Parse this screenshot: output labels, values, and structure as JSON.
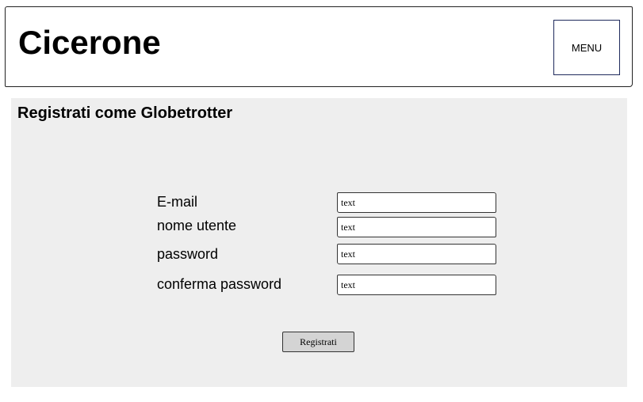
{
  "header": {
    "app_title": "Cicerone",
    "menu_label": "MENU"
  },
  "form": {
    "title": "Registrati come Globetrotter",
    "fields": [
      {
        "label": "E-mail",
        "value": "text"
      },
      {
        "label": "nome utente",
        "value": "text"
      },
      {
        "label": "password",
        "value": "text"
      },
      {
        "label": "conferma password",
        "value": "text"
      }
    ],
    "submit_label": "Registrati"
  }
}
